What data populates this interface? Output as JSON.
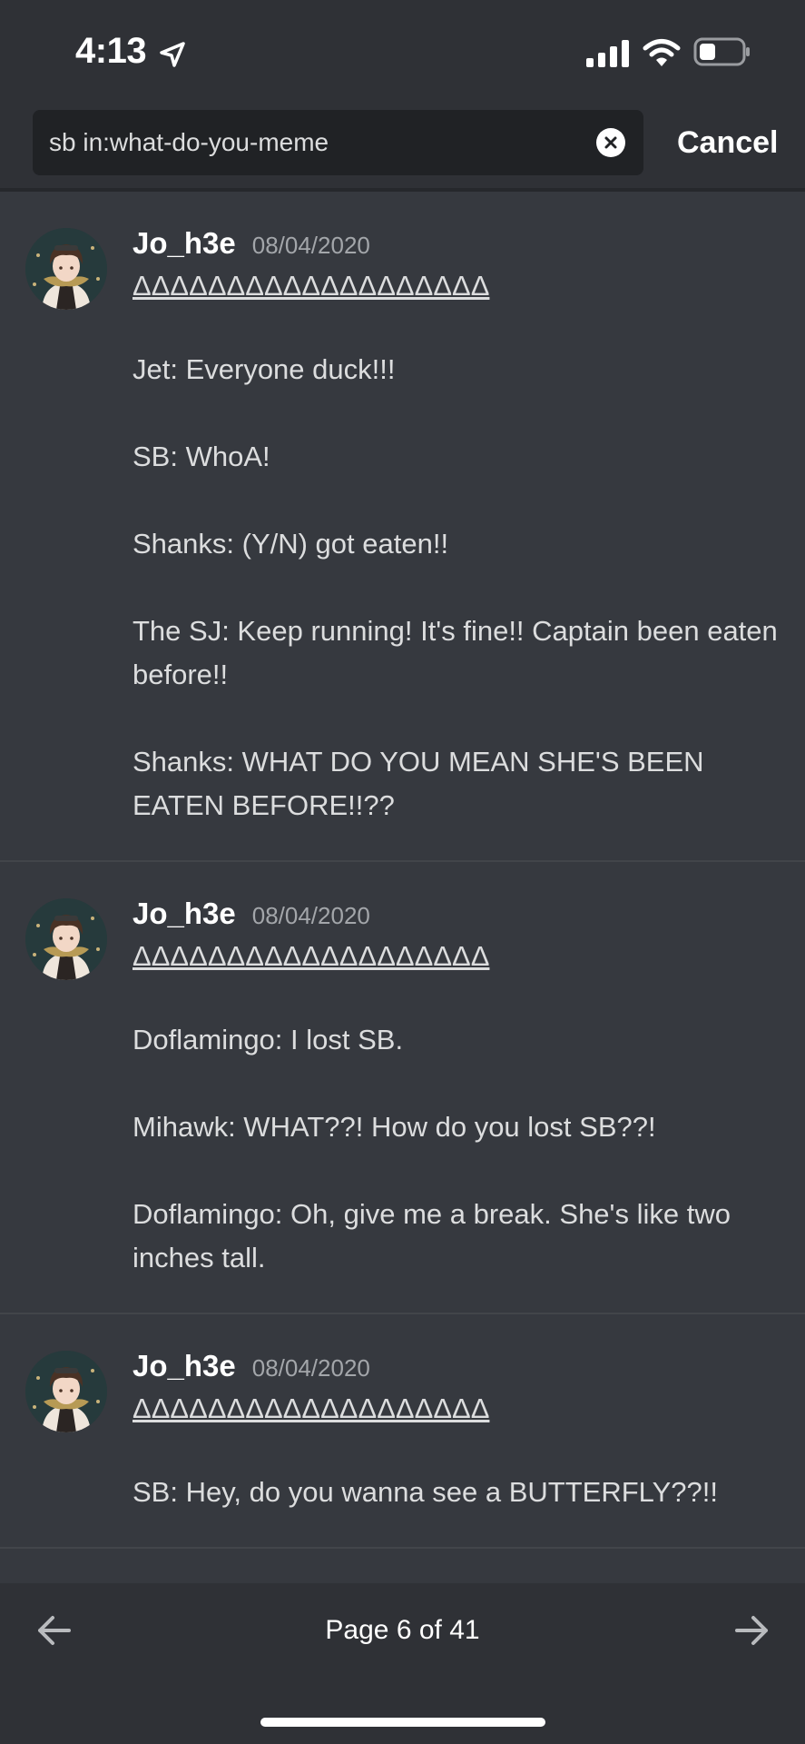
{
  "status_bar": {
    "time": "4:13",
    "icons": [
      "location-arrow-icon",
      "cellular-signal-icon",
      "wifi-icon",
      "battery-icon"
    ]
  },
  "search": {
    "query": "sb in:what-do-you-meme",
    "cancel_label": "Cancel"
  },
  "results": [
    {
      "author": "Jo_h3e",
      "timestamp": "08/04/2020",
      "header": "ΔΔΔΔΔΔΔΔΔΔΔΔΔΔΔΔΔΔΔ",
      "lines": [
        "Jet: Everyone duck!!!",
        "SB: WhoA!",
        "Shanks: (Y/N) got eaten!!",
        "The SJ: Keep running! It's fine!! Captain been eaten before!!",
        "Shanks: WHAT DO YOU MEAN SHE'S BEEN EATEN BEFORE!!??"
      ]
    },
    {
      "author": "Jo_h3e",
      "timestamp": "08/04/2020",
      "header": "ΔΔΔΔΔΔΔΔΔΔΔΔΔΔΔΔΔΔΔ",
      "lines": [
        "Doflamingo: I lost SB.",
        "Mihawk: WHAT??! How do you lost SB??!",
        "Doflamingo: Oh, give me a break. She's like two inches tall."
      ]
    },
    {
      "author": "Jo_h3e",
      "timestamp": "08/04/2020",
      "header": "ΔΔΔΔΔΔΔΔΔΔΔΔΔΔΔΔΔΔΔ",
      "lines": [
        "SB: Hey, do you wanna see a BUTTERFLY??!!"
      ]
    }
  ],
  "pager": {
    "label": "Page 6 of 41"
  },
  "colors": {
    "background": "#36393f",
    "header": "#2f3136",
    "search_box": "#202225",
    "text": "#dcddde",
    "muted": "#a3a6aa"
  }
}
